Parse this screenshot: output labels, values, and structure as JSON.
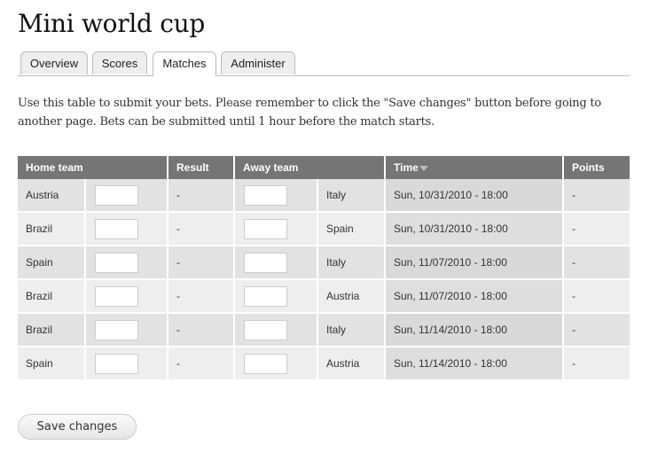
{
  "page": {
    "title": "Mini world cup",
    "intro": "Use this table to submit your bets. Please remember to click the \"Save changes\" button before going to another page. Bets can be submitted until 1 hour before the match starts."
  },
  "tabs": [
    {
      "label": "Overview",
      "active": false
    },
    {
      "label": "Scores",
      "active": false
    },
    {
      "label": "Matches",
      "active": true
    },
    {
      "label": "Administer",
      "active": false
    }
  ],
  "table": {
    "headers": {
      "home_team": "Home team",
      "result": "Result",
      "away_team": "Away team",
      "time": "Time",
      "points": "Points"
    },
    "sort_icon": "sort-descending-icon",
    "rows": [
      {
        "home": "Austria",
        "home_score": "",
        "result": "-",
        "away_score": "",
        "away": "Italy",
        "time": "Sun, 10/31/2010 - 18:00",
        "points": "-"
      },
      {
        "home": "Brazil",
        "home_score": "",
        "result": "-",
        "away_score": "",
        "away": "Spain",
        "time": "Sun, 10/31/2010 - 18:00",
        "points": "-"
      },
      {
        "home": "Spain",
        "home_score": "",
        "result": "-",
        "away_score": "",
        "away": "Italy",
        "time": "Sun, 11/07/2010 - 18:00",
        "points": "-"
      },
      {
        "home": "Brazil",
        "home_score": "",
        "result": "-",
        "away_score": "",
        "away": "Austria",
        "time": "Sun, 11/07/2010 - 18:00",
        "points": "-"
      },
      {
        "home": "Brazil",
        "home_score": "",
        "result": "-",
        "away_score": "",
        "away": "Italy",
        "time": "Sun, 11/14/2010 - 18:00",
        "points": "-"
      },
      {
        "home": "Spain",
        "home_score": "",
        "result": "-",
        "away_score": "",
        "away": "Austria",
        "time": "Sun, 11/14/2010 - 18:00",
        "points": "-"
      }
    ]
  },
  "actions": {
    "save_label": "Save changes"
  }
}
